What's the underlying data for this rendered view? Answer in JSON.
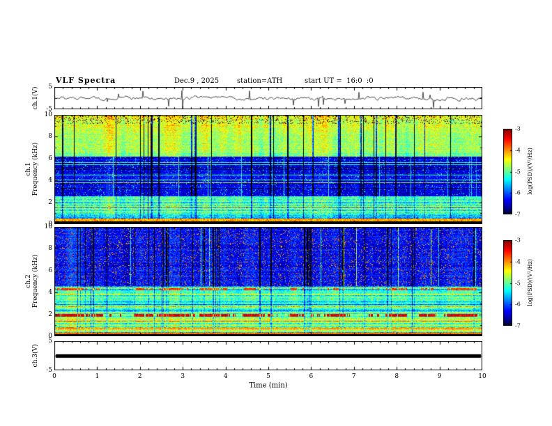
{
  "header": {
    "title": "VLF Spectra",
    "date": "Dec.9 , 2025",
    "station": "station=ATH",
    "start_ut": "start UT =  16:0  :0"
  },
  "xaxis": {
    "label": "Time (min)",
    "ticks": [
      "0",
      "1",
      "2",
      "3",
      "4",
      "5",
      "6",
      "7",
      "8",
      "9",
      "10"
    ],
    "range": [
      0,
      10
    ]
  },
  "panels": {
    "wf1": {
      "ylabel": "ch.1(V)",
      "yticks": [
        "5",
        "-5"
      ],
      "ylim": [
        -5,
        5
      ]
    },
    "sp1": {
      "ylabel_line1": "ch.1",
      "ylabel_line2": "Frequency (kHz)",
      "yticks": [
        "10",
        "8",
        "6",
        "4",
        "2",
        "0"
      ],
      "ylim": [
        0,
        10
      ]
    },
    "sp2": {
      "ylabel_line1": "ch.2",
      "ylabel_line2": "Frequency (kHz)",
      "yticks": [
        "10",
        "8",
        "6",
        "4",
        "2",
        "0"
      ],
      "ylim": [
        0,
        10
      ]
    },
    "wf3": {
      "ylabel": "ch.3(V)",
      "yticks": [
        "5",
        "-5"
      ],
      "ylim": [
        -5,
        5
      ]
    }
  },
  "colorbars": [
    {
      "label": "log(PSD)/(V²/Hz)",
      "ticks": [
        "-3",
        "-4",
        "-5",
        "-6",
        "-7"
      ],
      "range": [
        -7,
        -3
      ]
    },
    {
      "label": "log(PSD)/(V²/Hz)",
      "ticks": [
        "-3",
        "-4",
        "-5",
        "-6",
        "-7"
      ],
      "range": [
        -7,
        -3
      ]
    }
  ],
  "chart_data": [
    {
      "type": "line",
      "panel": "ch1-waveform",
      "ylabel": "ch.1(V)",
      "xlim": [
        0,
        10
      ],
      "ylim": [
        -5,
        5
      ],
      "summary": "Noisy broadband voltage trace centered near 0 V with dense impulsive spikes, many reaching -5 V and +3 V, fairly uniform over the 10 minutes"
    },
    {
      "type": "heatmap",
      "panel": "ch1-spectrogram",
      "ylabel": "ch.1 Frequency (kHz)",
      "xlim": [
        0,
        10
      ],
      "ylim": [
        0,
        10
      ],
      "zlabel": "log(PSD)/(V²/Hz)",
      "zlim": [
        -7,
        -3
      ],
      "colormap": "jet with black floor",
      "palette": [
        "#000000",
        "#0000a0",
        "#00ffff",
        "#00cc00",
        "#ffff00",
        "#ff0000"
      ],
      "summary": "Green/yellow high PSD above ~6 kHz with red speckle near 10 kHz, dark-blue low-PSD band ~2.5-6 kHz crossed by horizontal interference lines, green/cyan horizontal striping 0.5-2.5 kHz, black band below ~0.3 kHz, frequent vertical black sferic/dropout streaks through the whole record"
    },
    {
      "type": "heatmap",
      "panel": "ch2-spectrogram",
      "ylabel": "ch.2 Frequency (kHz)",
      "xlim": [
        0,
        10
      ],
      "ylim": [
        0,
        10
      ],
      "zlabel": "log(PSD)/(V²/Hz)",
      "zlim": [
        -7,
        -3
      ],
      "colormap": "jet with black floor",
      "palette": [
        "#000000",
        "#0000a0",
        "#00ffff",
        "#00cc00",
        "#ffff00",
        "#ff0000"
      ],
      "summary": "Dark-blue low-PSD region above ~4.5 kHz with many vertical black streaks and green speckle, strongly banded green/cyan region below ~4.5 kHz with orange/red horizontal interference lines near 2 kHz and 4.3 kHz, black band below ~0.2 kHz"
    },
    {
      "type": "line",
      "panel": "ch3-waveform",
      "ylabel": "ch.3(V)",
      "xlim": [
        0,
        10
      ],
      "ylim": [
        -5,
        5
      ],
      "value": 0,
      "summary": "Flat thick black line at ~0 V for the full record (channel inactive)"
    }
  ]
}
